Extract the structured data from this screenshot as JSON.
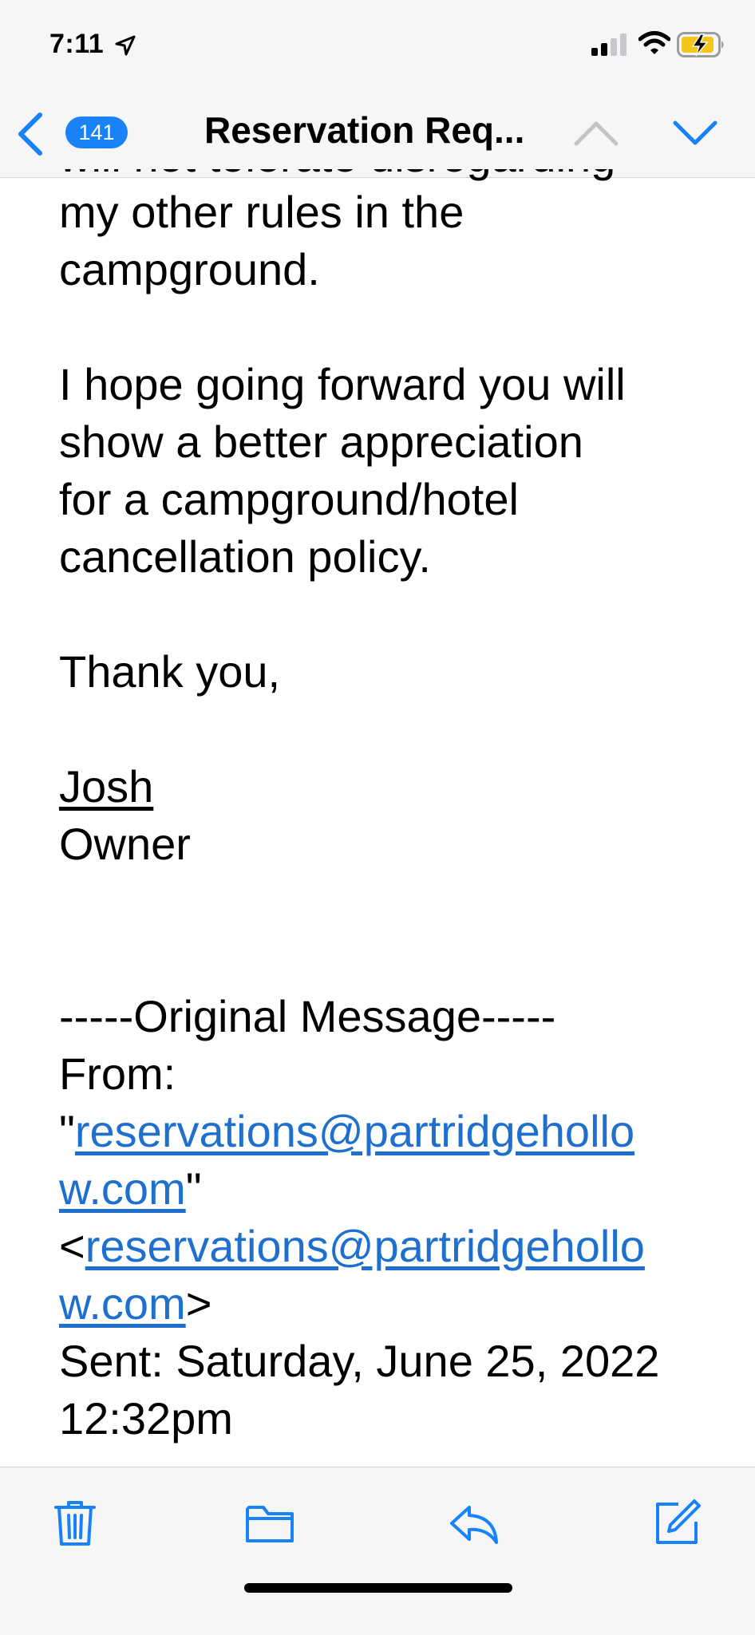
{
  "status_bar": {
    "time": "7:11",
    "icons": [
      "location-arrow-icon",
      "cellular-signal-icon",
      "wifi-icon",
      "battery-charging-icon"
    ]
  },
  "nav": {
    "back_icon": "chevron-left-icon",
    "unread_count": "141",
    "title": "Reservation Req...",
    "prev_icon": "chevron-up-icon",
    "next_icon": "chevron-down-icon",
    "accent_color": "#1a82f7"
  },
  "message": {
    "clipped_line": "will not tolerate disregarding",
    "lines": {
      "l1": "my other rules in the",
      "l2": "campground.",
      "l3": "I hope going forward you will",
      "l4": "show a better appreciation",
      "l5": "for a campground/hotel",
      "l6": "cancellation policy.",
      "l7": "Thank you,",
      "signature_name": "Josh",
      "signature_title": "Owner",
      "original_header": "-----Original Message-----",
      "from_label": "From:",
      "quote_open": "\"",
      "from_link_part1": "reservations@partridgehollo",
      "from_link_part2": "w.com",
      "quote_close": "\"",
      "angle_open": "<",
      "email_link_part1": "reservations@partridgehollo",
      "email_link_part2": "w.com",
      "angle_close": ">",
      "sent_line": "Sent: Saturday, June 25, 2022",
      "sent_time": "12:32pm"
    },
    "link_color": "#1f6fcf"
  },
  "toolbar": {
    "items": [
      "trash-icon",
      "folder-icon",
      "reply-icon",
      "compose-icon"
    ]
  }
}
